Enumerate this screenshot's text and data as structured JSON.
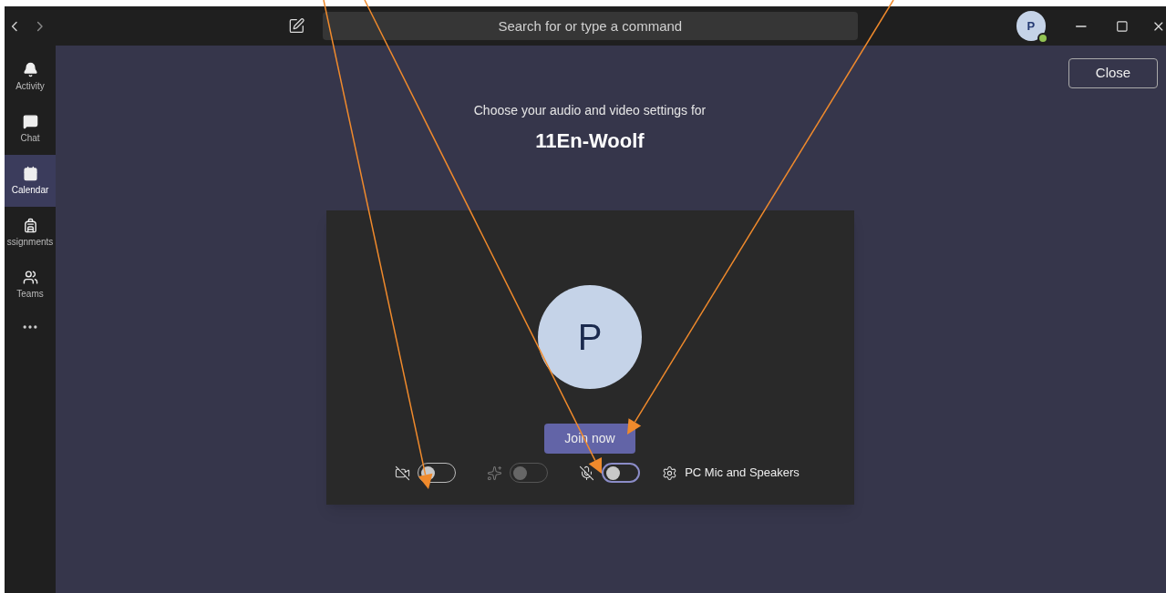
{
  "search": {
    "placeholder": "Search for or type a command"
  },
  "account": {
    "initial": "P"
  },
  "sidebar": {
    "items": [
      {
        "label": "Activity",
        "selected": false
      },
      {
        "label": "Chat",
        "selected": false
      },
      {
        "label": "Calendar",
        "selected": true
      },
      {
        "label": "ssignments",
        "selected": false
      },
      {
        "label": "Teams",
        "selected": false
      }
    ]
  },
  "close_button": "Close",
  "heading": "Choose your audio and video settings for",
  "meeting_name": "11En-Woolf",
  "preview": {
    "initial": "P"
  },
  "join_button": "Join now",
  "controls": [
    {
      "kind": "camera",
      "on": false,
      "disabled": false
    },
    {
      "kind": "blur",
      "on": false,
      "disabled": true
    },
    {
      "kind": "mic",
      "on": false,
      "disabled": false
    }
  ],
  "device": "PC Mic and Speakers"
}
